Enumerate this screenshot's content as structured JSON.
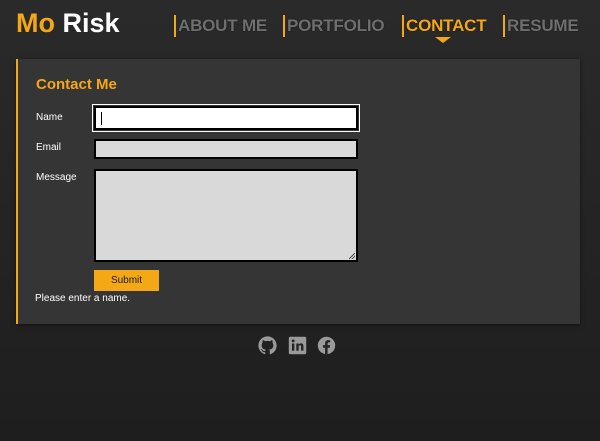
{
  "brand": {
    "first": "Mo",
    "last": "Risk"
  },
  "nav": {
    "items": [
      {
        "label": "ABOUT ME",
        "active": false
      },
      {
        "label": "PORTFOLIO",
        "active": false
      },
      {
        "label": "CONTACT",
        "active": true
      },
      {
        "label": "RESUME",
        "active": false
      }
    ]
  },
  "contact": {
    "title": "Contact Me",
    "fields": {
      "name_label": "Name",
      "email_label": "Email",
      "message_label": "Message",
      "name_value": "",
      "email_value": "",
      "message_value": ""
    },
    "submit_label": "Submit",
    "error_text": "Please enter a name."
  },
  "social": {
    "icons": [
      "github-icon",
      "linkedin-icon",
      "facebook-icon"
    ]
  },
  "colors": {
    "accent": "#f5a815",
    "background": "#232323",
    "card": "#353535",
    "nav_inactive": "#6f6f6f"
  }
}
